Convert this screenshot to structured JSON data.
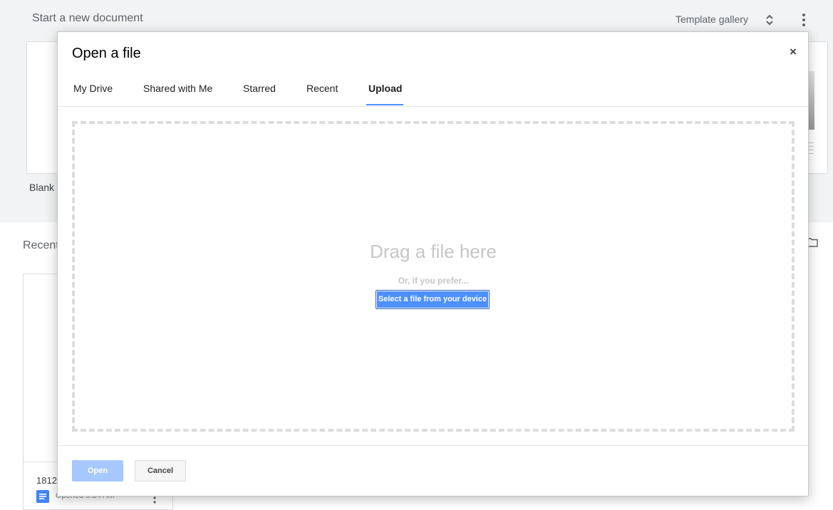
{
  "background": {
    "title": "Start a new document",
    "template_gallery": "Template gallery",
    "blank_label": "Blank",
    "recent_heading": "Recent",
    "card_name": "1812",
    "card_opened": "Opened 9:34 AM"
  },
  "dialog": {
    "title": "Open a file",
    "close": "×",
    "tabs": [
      {
        "label": "My Drive"
      },
      {
        "label": "Shared with Me"
      },
      {
        "label": "Starred"
      },
      {
        "label": "Recent"
      },
      {
        "label": "Upload",
        "active": true
      }
    ],
    "upload": {
      "drag_text": "Drag a file here",
      "prefer_text": "Or, if you prefer...",
      "select_button": "Select a file from your device"
    },
    "footer": {
      "open_label": "Open",
      "cancel_label": "Cancel"
    }
  },
  "colors": {
    "accent": "#4d90fe",
    "open_disabled": "#a6c8ff",
    "background_band": "#f1f3f4"
  },
  "icons": [
    "unfold-more-icon",
    "more-vert-icon",
    "folder-icon",
    "docs-icon",
    "close-icon"
  ]
}
